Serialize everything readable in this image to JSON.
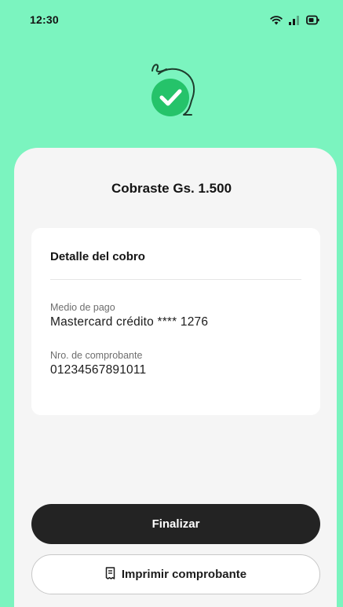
{
  "status_bar": {
    "time": "12:30",
    "icons": [
      "wifi-icon",
      "signal-icon",
      "battery-icon"
    ]
  },
  "hero": {
    "icon": "success-check-icon",
    "colors": {
      "accent": "#25c36a",
      "line": "#1e3d2d"
    }
  },
  "title": "Cobraste Gs. 1.500",
  "card": {
    "title": "Detalle del cobro",
    "fields": [
      {
        "label": "Medio de pago",
        "value": "Mastercard crédito **** 1276"
      },
      {
        "label": "Nro. de comprobante",
        "value": "01234567891011"
      }
    ]
  },
  "actions": {
    "primary_label": "Finalizar",
    "secondary_label": "Imprimir comprobante",
    "secondary_icon": "receipt-icon"
  },
  "colors": {
    "header_bg": "#7bf4bf",
    "sheet_bg": "#f5f5f5",
    "primary_button": "#232323"
  }
}
